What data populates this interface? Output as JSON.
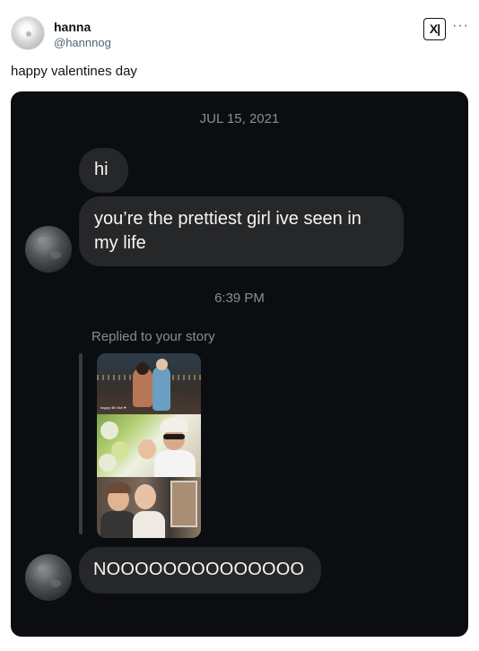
{
  "tweet": {
    "author_name": "hanna",
    "author_handle": "@hannnog",
    "text": "happy valentines day",
    "badge_text": "X|",
    "more_text": "···"
  },
  "conversation": {
    "date_separator": "JUL 15, 2021",
    "messages": [
      {
        "text": "hi"
      },
      {
        "text": "you’re the prettiest girl ive seen in my life"
      },
      {
        "text": "NOOOOOOOOOOOOOO"
      }
    ],
    "time_separator": "6:39 PM",
    "reply_label": "Replied to your story",
    "story_caption": "happy 4th thx! ♥"
  },
  "colors": {
    "chat_background": "#0b0d10",
    "bubble": "#262729",
    "meta_text": "#8a8d91"
  }
}
